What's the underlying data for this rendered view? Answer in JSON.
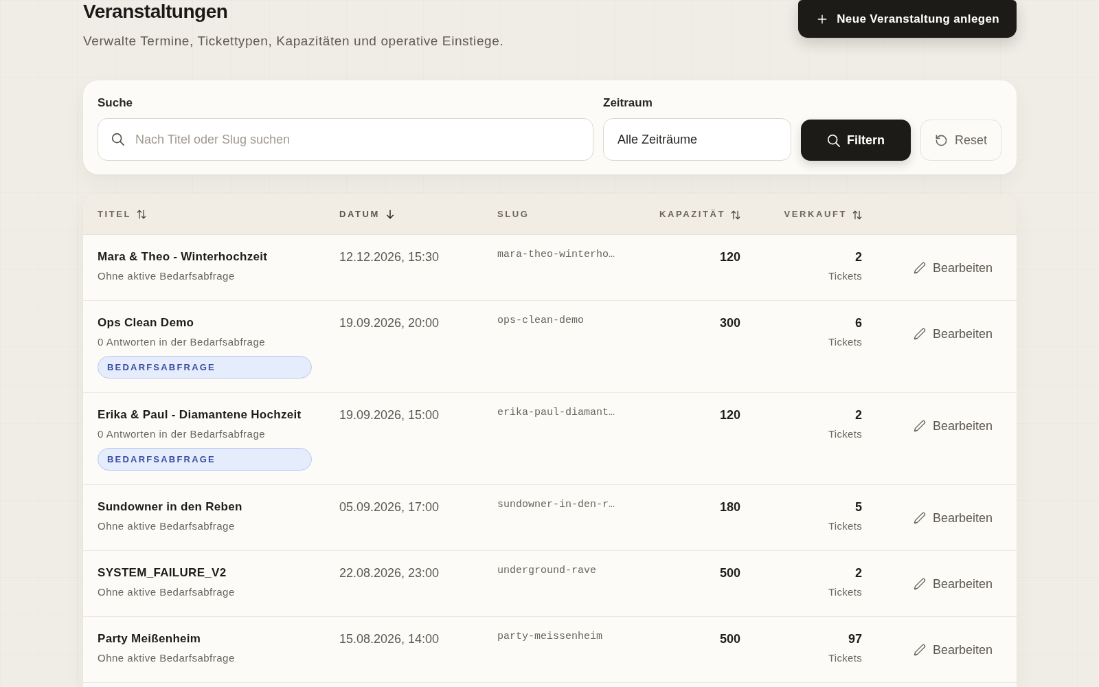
{
  "header": {
    "title": "Veranstaltungen",
    "subtitle": "Verwalte Termine, Tickettypen, Kapazitäten und operative Einstiege.",
    "create_button": {
      "label": "Neue Veranstaltung anlegen"
    }
  },
  "filters": {
    "search": {
      "label": "Suche",
      "placeholder": "Nach Titel oder Slug suchen"
    },
    "period": {
      "label": "Zeitraum",
      "value": "Alle Zeiträume"
    },
    "buttons": [
      {
        "kind": "primary",
        "label": "Filtern"
      },
      {
        "kind": "secondary",
        "label": "Reset"
      }
    ]
  },
  "table": {
    "columns": [
      {
        "label": "TITEL",
        "sortable": true,
        "sorted": false
      },
      {
        "label": "DATUM",
        "sortable": true,
        "sorted": true
      },
      {
        "label": "SLUG",
        "sortable": false,
        "sorted": false
      },
      {
        "label": "KAPAZITÄT",
        "sortable": true,
        "sorted": false
      },
      {
        "label": "VERKAUFT",
        "sortable": true,
        "sorted": false
      }
    ],
    "rows": [
      {
        "title": "Mara & Theo - Winterhochzeit",
        "survey_note": "Ohne aktive Bedarfsabfrage",
        "date": "12.12.2026, 15:30",
        "slug": "mara-theo-winterho…",
        "capacity": "120",
        "sold": "2",
        "sold_unit": "Tickets",
        "action": "Bearbeiten"
      },
      {
        "title": "Ops Clean Demo",
        "survey_note": "0 Antworten in der Bedarfsabfrage",
        "tag": "BEDARFSABFRAGE",
        "date": "19.09.2026, 20:00",
        "slug": "ops-clean-demo",
        "capacity": "300",
        "sold": "6",
        "sold_unit": "Tickets",
        "action": "Bearbeiten"
      },
      {
        "title": "Erika & Paul - Diamantene Hochzeit",
        "survey_note": "0 Antworten in der Bedarfsabfrage",
        "tag": "BEDARFSABFRAGE",
        "date": "19.09.2026, 15:00",
        "slug": "erika-paul-diamant…",
        "capacity": "120",
        "sold": "2",
        "sold_unit": "Tickets",
        "action": "Bearbeiten"
      },
      {
        "title": "Sundowner in den Reben",
        "survey_note": "Ohne aktive Bedarfsabfrage",
        "date": "05.09.2026, 17:00",
        "slug": "sundowner-in-den-r…",
        "capacity": "180",
        "sold": "5",
        "sold_unit": "Tickets",
        "action": "Bearbeiten"
      },
      {
        "title": "SYSTEM_FAILURE_V2",
        "survey_note": "Ohne aktive Bedarfsabfrage",
        "date": "22.08.2026, 23:00",
        "slug": "underground-rave",
        "capacity": "500",
        "sold": "2",
        "sold_unit": "Tickets",
        "action": "Bearbeiten"
      },
      {
        "title": "Party Meißenheim",
        "survey_note": "Ohne aktive Bedarfsabfrage",
        "date": "15.08.2026, 14:00",
        "slug": "party-meissenheim",
        "capacity": "500",
        "sold": "97",
        "sold_unit": "Tickets",
        "action": "Bearbeiten"
      }
    ]
  }
}
